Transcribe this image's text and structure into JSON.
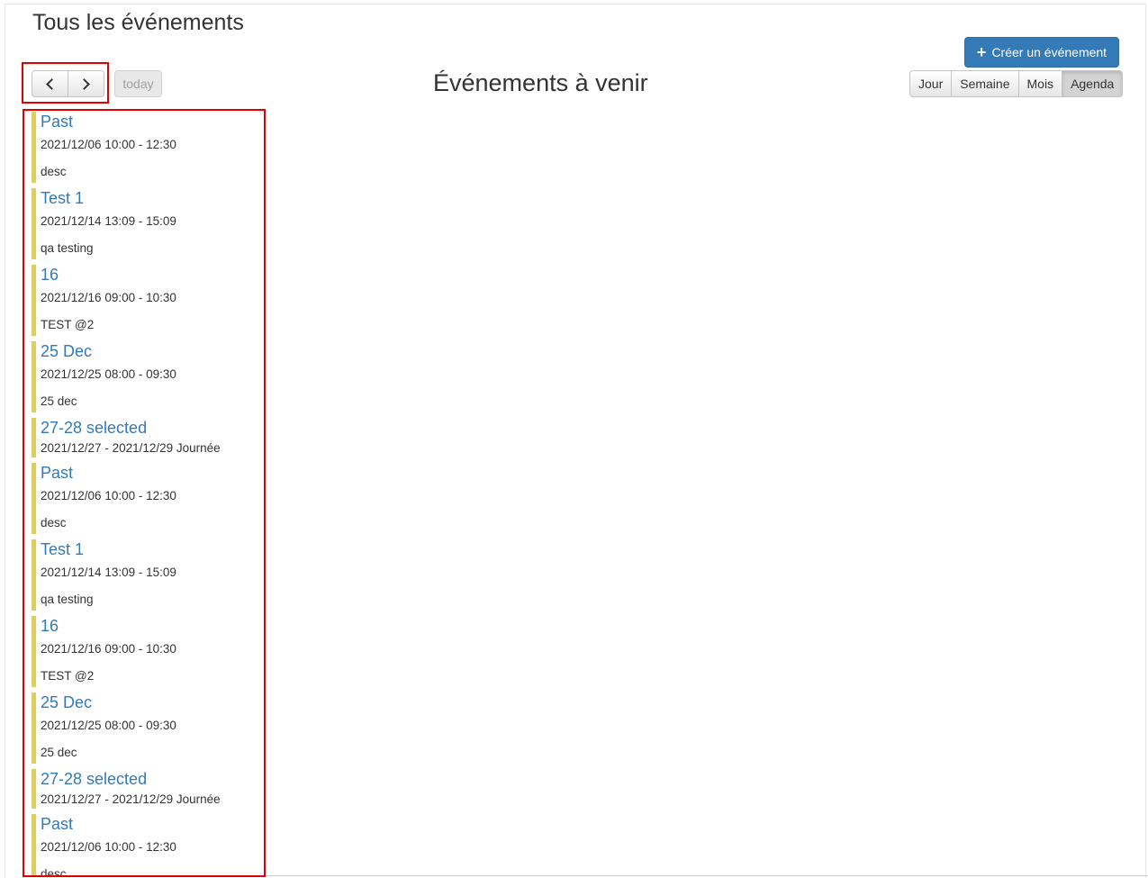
{
  "page_title": "Tous les événements",
  "create_button_label": "Créer un événement",
  "nav": {
    "prev_label": "",
    "next_label": "",
    "today_label": "today"
  },
  "view_title": "Événements à venir",
  "views": [
    {
      "label": "Jour",
      "active": false
    },
    {
      "label": "Semaine",
      "active": false
    },
    {
      "label": "Mois",
      "active": false
    },
    {
      "label": "Agenda",
      "active": true
    }
  ],
  "colors": {
    "event_bar": "#e3d04a",
    "link": "#337ab7",
    "primary_button": "#337ab7",
    "highlight_box": "#e00000"
  },
  "events": [
    {
      "title": "Past",
      "time": "2021/12/06 10:00 - 12:30",
      "desc": "desc"
    },
    {
      "title": "Test 1",
      "time": "2021/12/14 13:09 - 15:09",
      "desc": "qa testing"
    },
    {
      "title": "16",
      "time": "2021/12/16 09:00 - 10:30",
      "desc": "TEST @2"
    },
    {
      "title": "25 Dec",
      "time": "2021/12/25 08:00 - 09:30",
      "desc": "25 dec"
    },
    {
      "title": "27-28 selected",
      "time": "2021/12/27 - 2021/12/29 Journée",
      "desc": ""
    },
    {
      "title": "Past",
      "time": "2021/12/06 10:00 - 12:30",
      "desc": "desc"
    },
    {
      "title": "Test 1",
      "time": "2021/12/14 13:09 - 15:09",
      "desc": "qa testing"
    },
    {
      "title": "16",
      "time": "2021/12/16 09:00 - 10:30",
      "desc": "TEST @2"
    },
    {
      "title": "25 Dec",
      "time": "2021/12/25 08:00 - 09:30",
      "desc": "25 dec"
    },
    {
      "title": "27-28 selected",
      "time": "2021/12/27 - 2021/12/29 Journée",
      "desc": ""
    },
    {
      "title": "Past",
      "time": "2021/12/06 10:00 - 12:30",
      "desc": "desc"
    }
  ]
}
